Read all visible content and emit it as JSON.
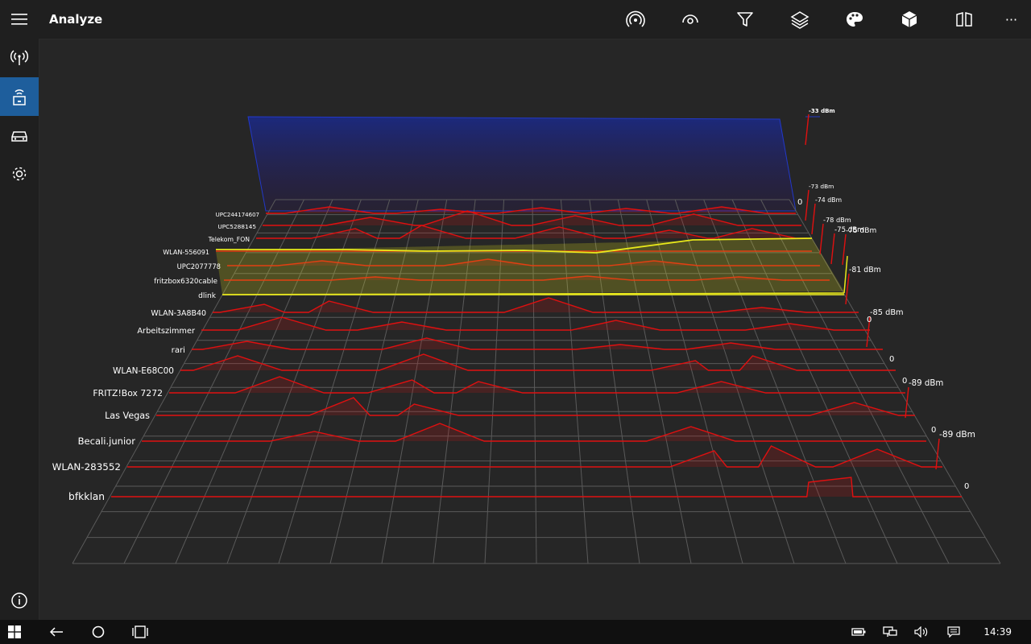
{
  "header": {
    "title": "Analyze"
  },
  "toolbar": {
    "items": [
      {
        "name": "wifi-scan-icon"
      },
      {
        "name": "eye-icon"
      },
      {
        "name": "filter-icon"
      },
      {
        "name": "layers-icon"
      },
      {
        "name": "palette-icon"
      },
      {
        "name": "cube-icon"
      },
      {
        "name": "compare-icon"
      },
      {
        "name": "more-icon",
        "label": "···"
      }
    ]
  },
  "sidebar": {
    "items": [
      {
        "name": "antenna-icon"
      },
      {
        "name": "router-icon",
        "active": true
      },
      {
        "name": "car-icon"
      },
      {
        "name": "gear-icon"
      },
      {
        "name": "info-icon"
      }
    ]
  },
  "chart_labels": {
    "networks": [
      "UPC244174607",
      "UPC5288145",
      "Telekom_FON",
      "WLAN-556091",
      "UPC2077778",
      "fritzbox6320cable",
      "dlink",
      "WLAN-3A8B40",
      "Arbeitszimmer",
      "rari",
      "WLAN-E68C00",
      "FRITZ!Box 7272",
      "Las Vegas",
      "Becali.junior",
      "WLAN-283552",
      "bfkklan"
    ],
    "highlighted": "dlink",
    "dbm_labels": [
      "-33 dBm",
      "-73 dBm",
      "-74 dBm",
      "-78 dBm",
      "-75 dBm",
      "-75 dBm",
      "-81 dBm",
      "-85 dBm",
      "-89 dBm",
      "-89 dBm"
    ],
    "zero_label": "0"
  },
  "colors": {
    "accent": "#1e5e9c",
    "signal": "#e01010",
    "highlight": "#e8e81a",
    "max_plane": "#1a2a8c"
  },
  "taskbar": {
    "time": "14:39"
  }
}
